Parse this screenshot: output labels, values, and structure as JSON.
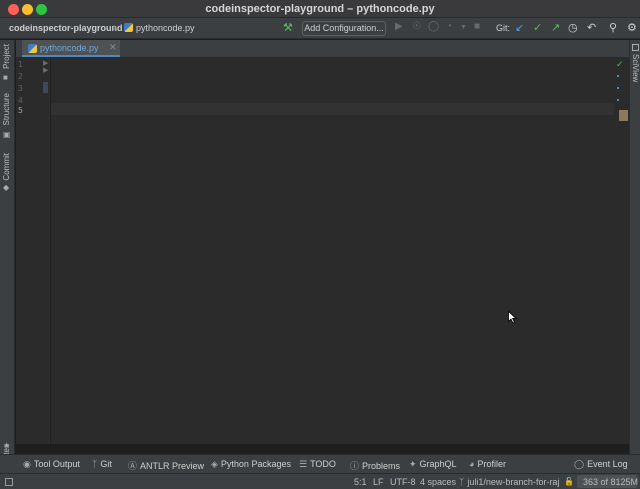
{
  "window": {
    "title": "codeinspector-playground – pythoncode.py"
  },
  "toolbar": {
    "project_name": "codeinspector-playground",
    "separator": "›",
    "file_name": "pythoncode.py",
    "add_configuration_label": "Add Configuration...",
    "git_label": "Git:"
  },
  "left_strip": {
    "project": "Project",
    "structure": "Structure",
    "commit": "Commit",
    "favorites": "Favorites"
  },
  "right_strip": {
    "sciview": "SciView"
  },
  "editor": {
    "tab_label": "pythoncode.py",
    "line_numbers": [
      "1",
      "2",
      "3",
      "4",
      "5"
    ],
    "current_line": 5
  },
  "bottom_tools": [
    {
      "icon": "tool-output-icon",
      "label": "Tool Output"
    },
    {
      "icon": "git-branch-icon",
      "label": "Git"
    },
    {
      "icon": "antlr-icon",
      "label": "ANTLR Preview"
    },
    {
      "icon": "python-packages-icon",
      "label": "Python Packages"
    },
    {
      "icon": "todo-icon",
      "label": "TODO"
    },
    {
      "icon": "problems-icon",
      "label": "Problems"
    },
    {
      "icon": "graphql-icon",
      "label": "GraphQL"
    },
    {
      "icon": "profiler-icon",
      "label": "Profiler"
    },
    {
      "icon": "event-log-icon",
      "label": "Event Log"
    }
  ],
  "status": {
    "position": "5:1",
    "line_separator": "LF",
    "encoding": "UTF-8",
    "indent": "4 spaces",
    "branch": "juli1/new-branch-for-raj",
    "memory": "363 of 8125M"
  },
  "colors": {
    "accent": "#4a88c7",
    "run_green": "#5fb85f",
    "git_update_blue": "#4a9ce0"
  }
}
